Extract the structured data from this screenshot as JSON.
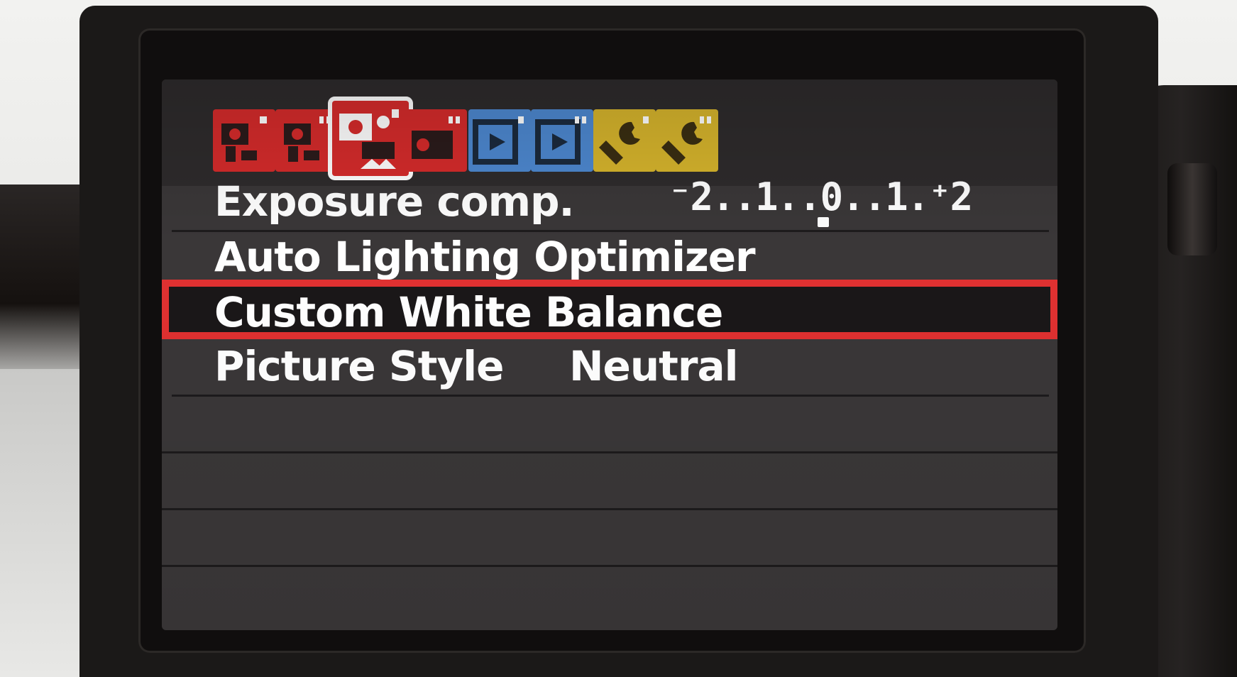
{
  "tabs": [
    {
      "color": "#d52b2b",
      "icon": "shooting-menu-1-icon",
      "selected": false
    },
    {
      "color": "#d52b2b",
      "icon": "shooting-menu-2-icon",
      "selected": false
    },
    {
      "color": "#d52b2b",
      "icon": "movie-menu-icon",
      "selected": true
    },
    {
      "color": "#d52b2b",
      "icon": "shooting-menu-4-icon",
      "selected": false
    },
    {
      "color": "#4d88d0",
      "icon": "playback-menu-1-icon",
      "selected": false
    },
    {
      "color": "#4d88d0",
      "icon": "playback-menu-2-icon",
      "selected": false
    },
    {
      "color": "#d6b42c",
      "icon": "setup-menu-1-icon",
      "selected": false
    },
    {
      "color": "#d6b42c",
      "icon": "setup-menu-2-icon",
      "selected": false
    }
  ],
  "menu": {
    "exposure": {
      "label": "Exposure comp.",
      "scale": "⁻2..1..0..1.⁺2",
      "value": 0
    },
    "alo": {
      "label": "Auto Lighting Optimizer"
    },
    "cwb": {
      "label": "Custom White Balance"
    },
    "picture_style": {
      "label": "Picture Style",
      "value": "Neutral"
    }
  },
  "colors": {
    "highlight": "#e03131",
    "screen_bg": "#3a3738"
  }
}
